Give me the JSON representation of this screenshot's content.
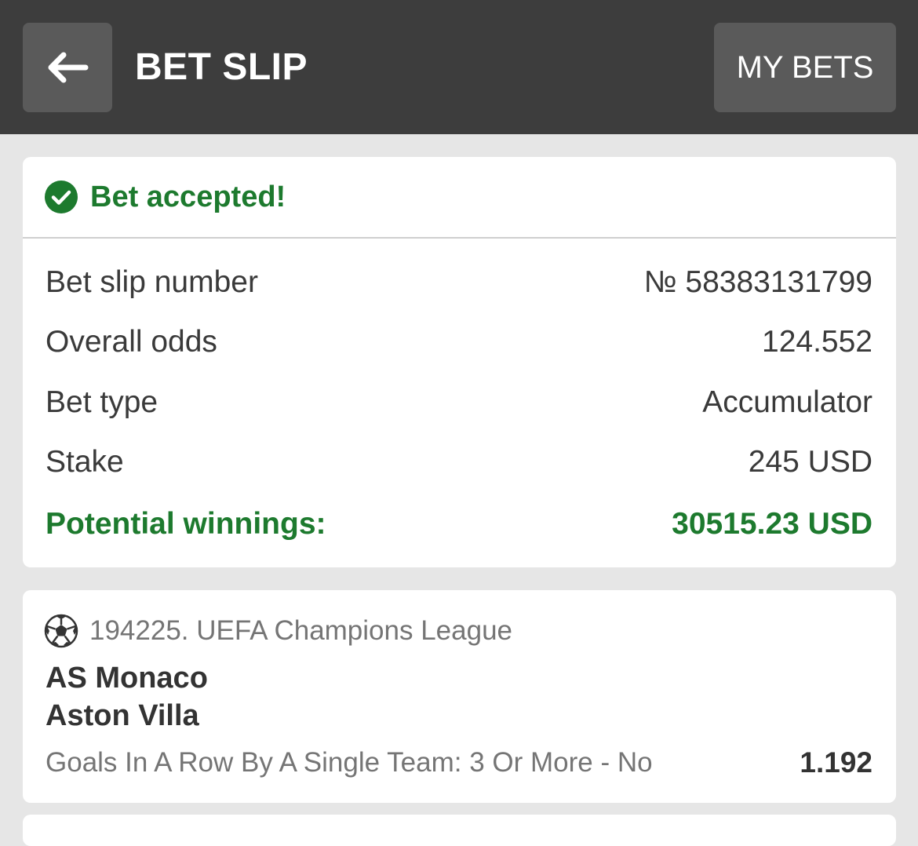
{
  "header": {
    "title": "BET SLIP",
    "back_icon": "arrow-left-icon",
    "my_bets_label": "MY BETS"
  },
  "status": {
    "icon": "check-circle-icon",
    "text": "Bet accepted!",
    "color": "#1d7a2e"
  },
  "details": [
    {
      "label": "Bet slip number",
      "value": "№ 58383131799"
    },
    {
      "label": "Overall odds",
      "value": "124.552"
    },
    {
      "label": "Bet type",
      "value": "Accumulator"
    },
    {
      "label": "Stake",
      "value": "245 USD"
    }
  ],
  "potential_winnings": {
    "label": "Potential winnings:",
    "value": "30515.23 USD"
  },
  "events": [
    {
      "sport_icon": "soccer-ball-icon",
      "league": "194225. UEFA Champions League",
      "team1": "AS Monaco",
      "team2": "Aston Villa",
      "market": "Goals In A Row By A Single Team: 3 Or More - No",
      "odds": "1.192"
    }
  ],
  "colors": {
    "header_bg": "#3d3d3d",
    "button_bg": "#5a5a5a",
    "page_bg": "#e6e6e6",
    "accent_green": "#1d7a2e"
  }
}
